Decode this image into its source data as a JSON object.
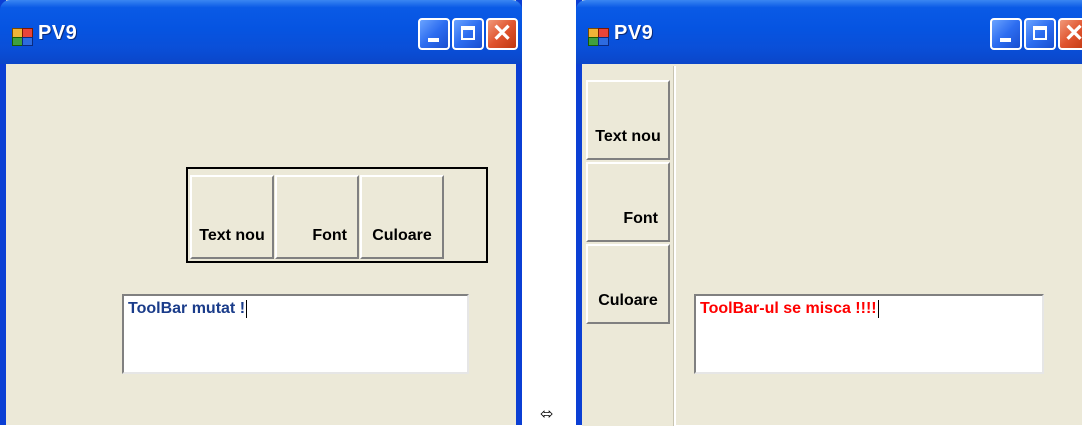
{
  "left_window": {
    "title": "PV9",
    "toolbar": {
      "buttons": [
        "Text nou",
        "Font",
        "Culoare"
      ]
    },
    "textbox": {
      "value": "ToolBar mutat !",
      "color": "#1a3c8a"
    }
  },
  "right_window": {
    "title": "PV9",
    "toolbar": {
      "buttons": [
        "Text nou",
        "Font",
        "Culoare"
      ]
    },
    "textbox": {
      "value": "ToolBar-ul se misca !!!!",
      "color": "#ff0000"
    }
  },
  "separator_glyph": "⬄",
  "colors": {
    "titlebar": "#0a5ae6",
    "window_bg": "#ece9d8",
    "close_button": "#e0542e"
  },
  "icons": [
    "app-icon",
    "minimize-icon",
    "maximize-icon",
    "close-icon"
  ]
}
